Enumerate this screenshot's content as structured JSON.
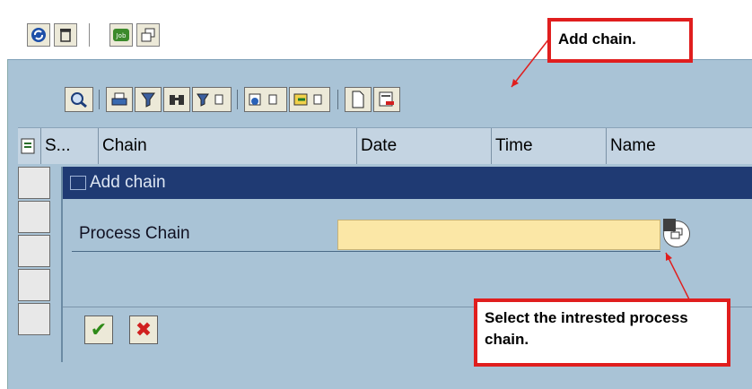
{
  "grid": {
    "columns": [
      "S...",
      "Chain",
      "Date",
      "Time",
      "Name"
    ]
  },
  "dialog": {
    "title": "Add chain",
    "field_label": "Process Chain",
    "field_value": "",
    "ok_symbol": "✔",
    "cancel_symbol": "✖"
  },
  "callouts": {
    "add_chain": "Add chain.",
    "select_chain": "Select the intrested process chain."
  },
  "colors": {
    "callout_border": "#e01e1e",
    "dialog_title_bg": "#1f3a73",
    "input_bg": "#fbe7a6"
  }
}
